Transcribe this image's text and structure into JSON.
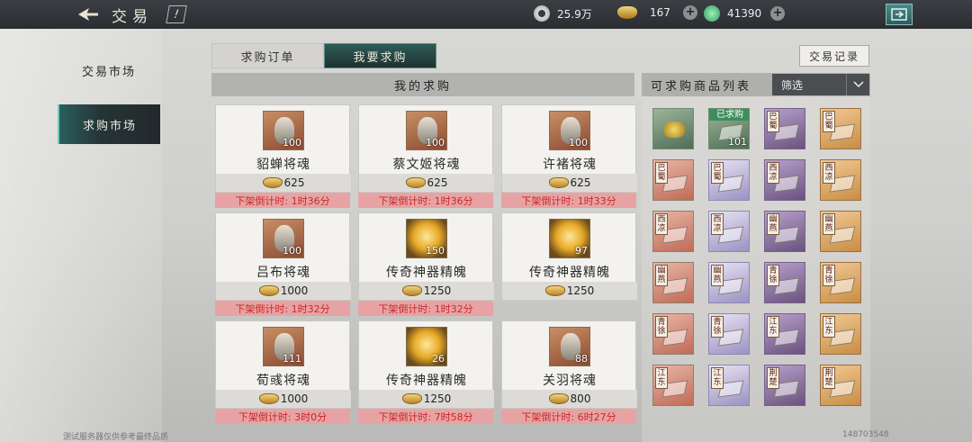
{
  "topbar": {
    "title": "交易",
    "info_label": "!",
    "resources": [
      {
        "name": "coin",
        "value": "25.9万",
        "icon": "coin-icon",
        "color": "#d8d8d8"
      },
      {
        "name": "ingot",
        "value": "167",
        "icon": "gold-ingot-icon",
        "color": "#e0b44a"
      },
      {
        "name": "jade",
        "value": "41390",
        "icon": "jade-icon",
        "color": "#4fc07f"
      }
    ],
    "plus_label": "+"
  },
  "nav": {
    "items": [
      {
        "label": "交易市场",
        "active": false
      },
      {
        "label": "求购市场",
        "active": true
      }
    ]
  },
  "tabs": [
    {
      "label": "求购订单",
      "active": false
    },
    {
      "label": "我要求购",
      "active": true
    }
  ],
  "record_button": "交易记录",
  "my_orders": {
    "header": "我的求购",
    "countdown_prefix": "下架倒计时:",
    "orders": [
      {
        "name": "貂蝉将魂",
        "qty": "100",
        "price": "625",
        "countdown": "下架倒计时:  1时36分",
        "thumb": "portrait"
      },
      {
        "name": "蔡文姬将魂",
        "qty": "100",
        "price": "625",
        "countdown": "下架倒计时:  1时36分",
        "thumb": "portrait"
      },
      {
        "name": "许褚将魂",
        "qty": "100",
        "price": "625",
        "countdown": "下架倒计时:  1时33分",
        "thumb": "portrait"
      },
      {
        "name": "吕布将魂",
        "qty": "100",
        "price": "1000",
        "countdown": "下架倒计时:  1时32分",
        "thumb": "portrait"
      },
      {
        "name": "传奇神器精魄",
        "qty": "150",
        "price": "1250",
        "countdown": "下架倒计时:  1时32分",
        "thumb": "gold"
      },
      {
        "name": "传奇神器精魄",
        "qty": "97",
        "price": "1250",
        "countdown": "",
        "thumb": "gold"
      },
      {
        "name": "荀彧将魂",
        "qty": "111",
        "price": "1000",
        "countdown": "下架倒计时:  3时0分",
        "thumb": "portrait"
      },
      {
        "name": "传奇神器精魄",
        "qty": "26",
        "price": "1250",
        "countdown": "下架倒计时:  7时58分",
        "thumb": "gold"
      },
      {
        "name": "关羽将魂",
        "qty": "88",
        "price": "800",
        "countdown": "下架倒计时:  6时27分",
        "thumb": "portrait"
      }
    ]
  },
  "goods_list": {
    "header": "可求购商品列表",
    "filter_label": "筛选",
    "items": [
      {
        "tag": "",
        "style": "green",
        "kind": "gem"
      },
      {
        "tag": "",
        "style": "green",
        "kind": "bought",
        "bought_label": "已求购",
        "count": "101"
      },
      {
        "tag": "巴蜀",
        "style": "purple"
      },
      {
        "tag": "巴蜀",
        "style": "orange"
      },
      {
        "tag": "巴蜀",
        "style": "red"
      },
      {
        "tag": "巴蜀",
        "style": "blue"
      },
      {
        "tag": "西凉",
        "style": "purple"
      },
      {
        "tag": "西凉",
        "style": "orange"
      },
      {
        "tag": "西凉",
        "style": "red"
      },
      {
        "tag": "西凉",
        "style": "blue"
      },
      {
        "tag": "幽燕",
        "style": "purple"
      },
      {
        "tag": "幽燕",
        "style": "orange"
      },
      {
        "tag": "幽燕",
        "style": "red"
      },
      {
        "tag": "幽燕",
        "style": "blue"
      },
      {
        "tag": "青徐",
        "style": "purple"
      },
      {
        "tag": "青徐",
        "style": "orange"
      },
      {
        "tag": "青徐",
        "style": "red"
      },
      {
        "tag": "青徐",
        "style": "blue"
      },
      {
        "tag": "江东",
        "style": "purple"
      },
      {
        "tag": "江东",
        "style": "orange"
      },
      {
        "tag": "江东",
        "style": "red"
      },
      {
        "tag": "江东",
        "style": "blue"
      },
      {
        "tag": "荆楚",
        "style": "purple"
      },
      {
        "tag": "荆楚",
        "style": "orange"
      }
    ]
  },
  "footer": {
    "left": "测试服务器仅供参考最终品质",
    "right": "148703548"
  }
}
